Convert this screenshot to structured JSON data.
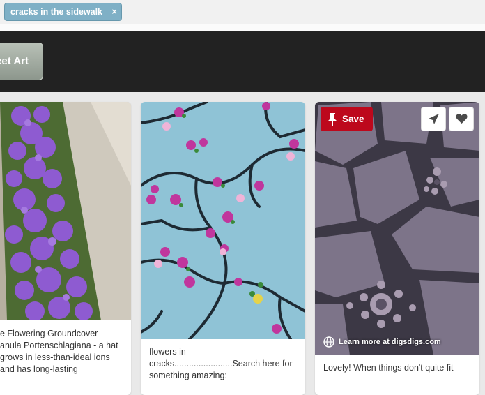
{
  "search": {
    "chip_label": "cracks in the sidewalk",
    "chip_close": "×"
  },
  "header": {
    "tag_button_label": "eet Art"
  },
  "pins": [
    {
      "description": "e Flowering Groundcover - anula Portenschlagiana - a hat grows in less-than-ideal ions and has long-lasting"
    },
    {
      "description": "flowers in cracks........................Search here for something amazing:"
    },
    {
      "save_label": "Save",
      "source_label": "Learn more at digsdigs.com",
      "description": "Lovely! When things don't quite fit"
    }
  ],
  "colors": {
    "chip_bg": "#7fb0c6",
    "save_red": "#bd081c",
    "dark_bar": "#222222"
  },
  "icons": [
    "pin-icon",
    "send-icon",
    "heart-icon",
    "globe-icon",
    "close-icon"
  ]
}
